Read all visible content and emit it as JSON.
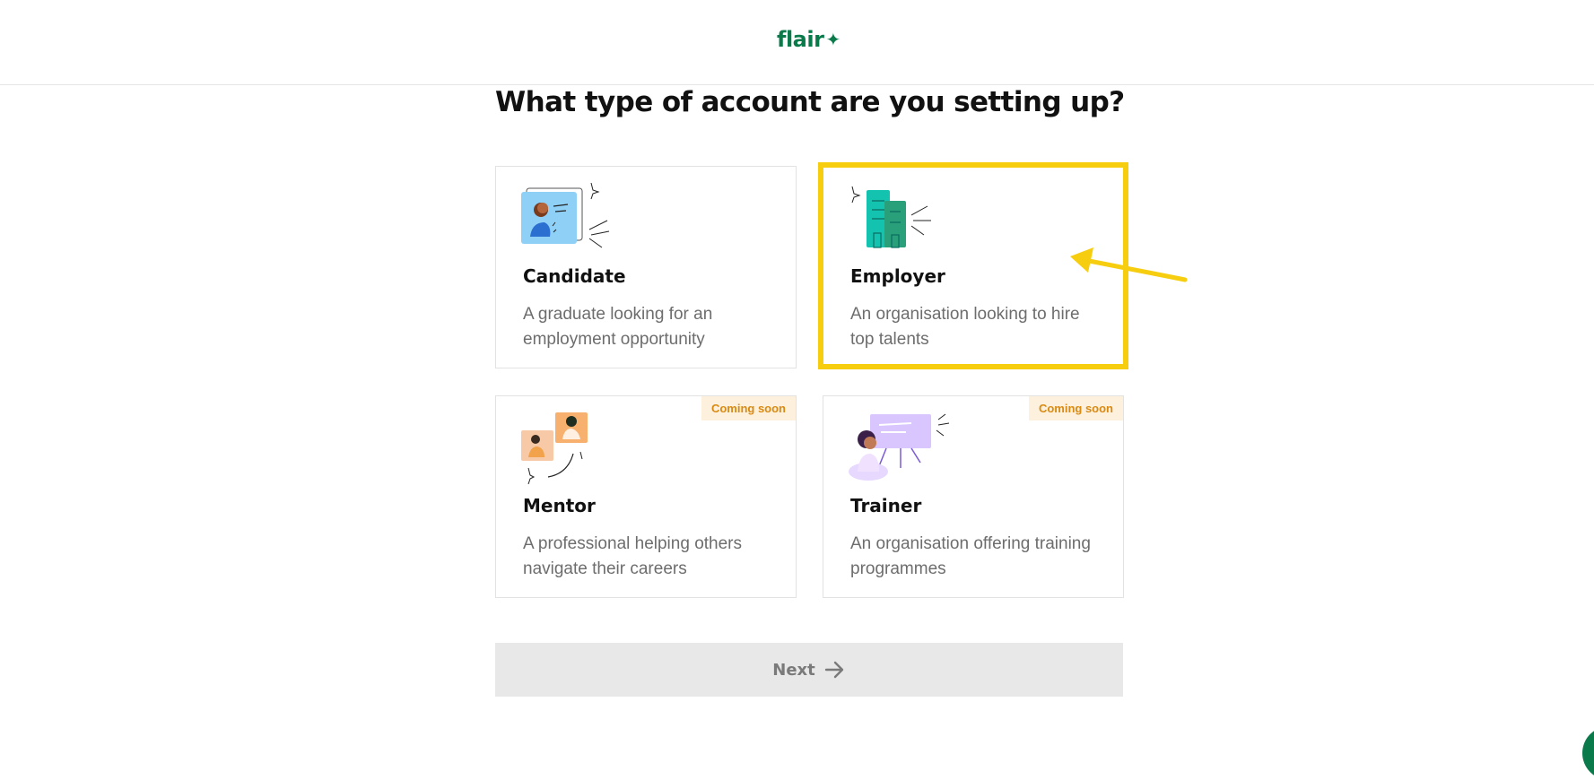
{
  "brand": {
    "name": "flair",
    "spark": "✦",
    "color": "#0b7a4b"
  },
  "page": {
    "heading": "What type of account are you setting up?"
  },
  "cards": [
    {
      "id": "candidate",
      "title": "Candidate",
      "desc": "A graduate looking for an employment opportunity",
      "badge": ""
    },
    {
      "id": "employer",
      "title": "Employer",
      "desc": "An organisation looking to hire top talents",
      "badge": ""
    },
    {
      "id": "mentor",
      "title": "Mentor",
      "desc": "A professional helping others navigate their careers",
      "badge": "Coming soon"
    },
    {
      "id": "trainer",
      "title": "Trainer",
      "desc": "An organisation offering training programmes",
      "badge": "Coming soon"
    }
  ],
  "next_button": {
    "label": "Next",
    "icon": "arrow-right-icon"
  },
  "annotation": {
    "highlight_color": "#f7cd0f",
    "target": "employer"
  },
  "colors": {
    "badge_bg": "#fdf1de",
    "badge_text": "#d98a12",
    "disabled_bg": "#e8e8e8"
  }
}
